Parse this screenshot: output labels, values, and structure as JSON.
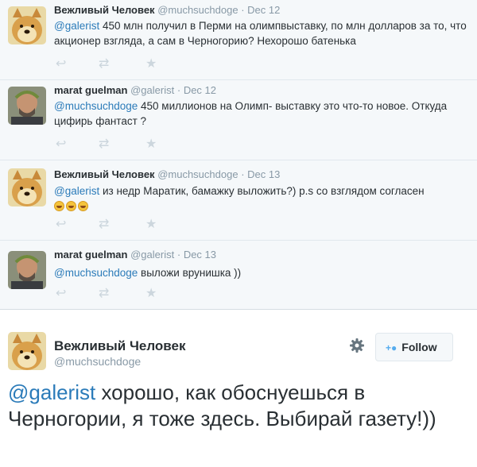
{
  "thread": [
    {
      "name": "Вежливый Человек",
      "handle": "@muchsuchdoge",
      "date": "Dec 12",
      "avatar": "doge-avatar",
      "mention": "@galerist",
      "text": " 450 млн получил в Перми на олимпвыставку, по млн долларов за то, что акционер взгляда, а сам в Черногорию? Нехорошо батенька"
    },
    {
      "name": "marat guelman",
      "handle": "@galerist",
      "date": "Dec 12",
      "avatar": "man-avatar",
      "mention": "@muchsuchdoge",
      "text": " 450 миллионов на Олимп- выставку это что-то новое. Откуда цифирь фантаст ?"
    },
    {
      "name": "Вежливый Человек",
      "handle": "@muchsuchdoge",
      "date": "Dec 13",
      "avatar": "doge-avatar",
      "mention": "@galerist",
      "text": " из недр Маратик, бамажку выложить?) p.s со взглядом согласен",
      "emoji": "face-with-tears-of-joy ×3"
    },
    {
      "name": "marat guelman",
      "handle": "@galerist",
      "date": "Dec 13",
      "avatar": "man-avatar",
      "mention": "@muchsuchdoge",
      "text": " выложи врунишка ))"
    }
  ],
  "separator": "·",
  "actions": {
    "reply_icon": "reply-icon",
    "retweet_icon": "retweet-icon",
    "favorite_icon": "star-icon"
  },
  "main_tweet": {
    "name": "Вежливый Человек",
    "handle": "@muchsuchdoge",
    "follow_label": "Follow",
    "mention": "@galerist",
    "text": " хорошо, как обоснуешься в Черногории, я тоже здесь. Выбирай газету!))"
  },
  "colors": {
    "link": "#2b7bb9",
    "muted": "#8899a6",
    "icon": "#ccd6dd",
    "follow_icon": "#55acee"
  }
}
